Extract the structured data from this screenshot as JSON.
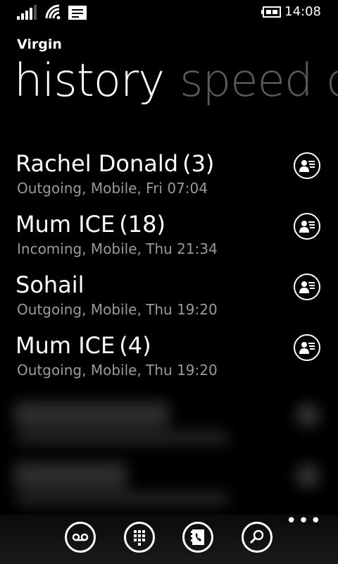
{
  "status": {
    "time": "14:08"
  },
  "carrier": "Virgin",
  "pivot": {
    "active": "history",
    "next": "speed d"
  },
  "calls": [
    {
      "name": "Rachel Donald",
      "count": "(3)",
      "detail": "Outgoing, Mobile, Fri 07:04"
    },
    {
      "name": "Mum ICE",
      "count": "(18)",
      "detail": "Incoming, Mobile, Thu 21:34"
    },
    {
      "name": "Sohail",
      "count": "",
      "detail": "Outgoing, Mobile, Thu 19:20"
    },
    {
      "name": "Mum ICE",
      "count": "(4)",
      "detail": "Outgoing, Mobile, Thu 19:20"
    }
  ],
  "icons": {
    "signal": "signal-strength-icon",
    "wifi": "wifi-icon",
    "messages": "messaging-icon",
    "battery": "battery-charging-icon",
    "contact": "contact-card-icon",
    "voicemail": "voicemail-icon",
    "keypad": "keypad-icon",
    "phonebook": "phonebook-icon",
    "search": "search-icon",
    "more": "more-icon"
  },
  "appbar": {
    "more": "•••"
  }
}
